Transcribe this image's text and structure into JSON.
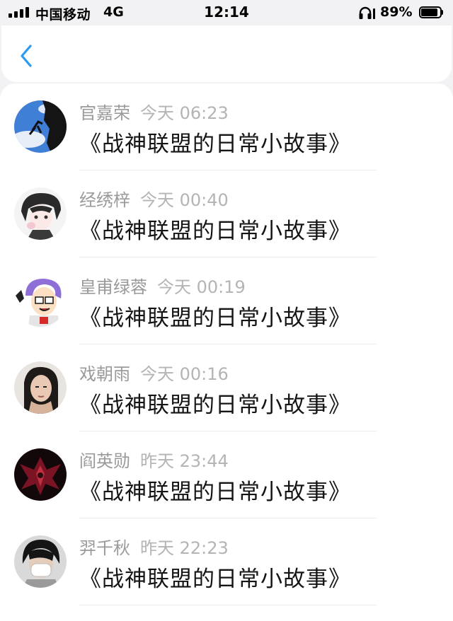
{
  "status_bar": {
    "carrier": "中国移动",
    "network": "4G",
    "time": "12:14",
    "battery": "89%",
    "battery_level": 0.89
  },
  "nav": {
    "back_icon": "chevron-left-icon",
    "accent": "#2b9af3"
  },
  "comments": [
    {
      "name": "官嘉荣",
      "time": "今天 06:23",
      "message": "《战神联盟的日常小故事》",
      "avatar": "rock-climber-avatar"
    },
    {
      "name": "经绣梓",
      "time": "今天 00:40",
      "message": "《战神联盟的日常小故事》",
      "avatar": "anime-character-avatar"
    },
    {
      "name": "皇甫绿蓉",
      "time": "今天 00:19",
      "message": "《战神联盟的日常小故事》",
      "avatar": "cartoon-character-avatar"
    },
    {
      "name": "戏朝雨",
      "time": "今天 00:16",
      "message": "《战神联盟的日常小故事》",
      "avatar": "portrait-avatar"
    },
    {
      "name": "阎英勋",
      "time": "昨天 23:44",
      "message": "《战神联盟的日常小故事》",
      "avatar": "dark-art-avatar"
    },
    {
      "name": "羿千秋",
      "time": "昨天 22:23",
      "message": "《战神联盟的日常小故事》",
      "avatar": "masked-person-avatar"
    }
  ]
}
